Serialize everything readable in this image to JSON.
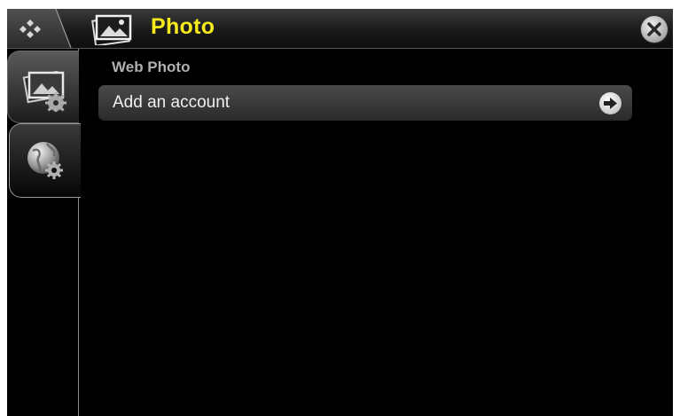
{
  "header": {
    "title": "Photo",
    "title_color": "#f4ea1c",
    "menu_icon": "diamond-dots-icon",
    "title_icon": "photo-frame-icon",
    "close_icon": "close-icon"
  },
  "sidebar": {
    "items": [
      {
        "icon": "photo-settings-icon",
        "selected": false
      },
      {
        "icon": "globe-settings-icon",
        "selected": true
      }
    ]
  },
  "main": {
    "section_title": "Web Photo",
    "items": [
      {
        "label": "Add an account",
        "icon": "arrow-right-icon"
      }
    ]
  }
}
